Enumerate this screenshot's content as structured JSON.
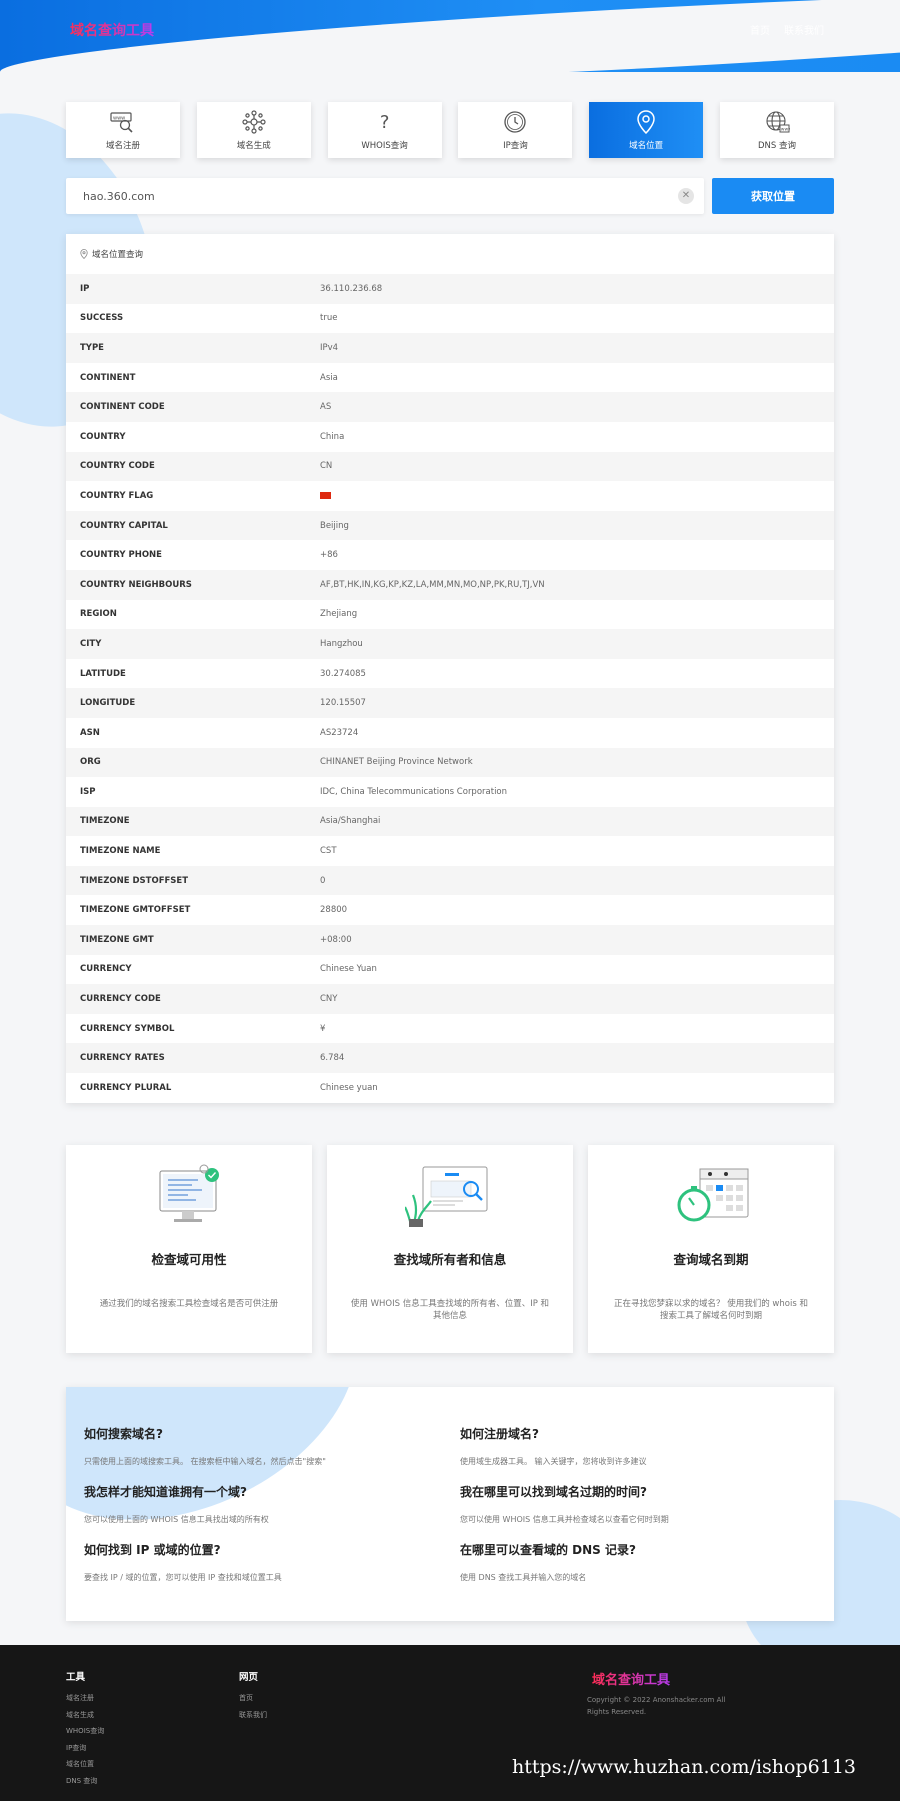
{
  "header": {
    "logo": "域名查询工具",
    "nav": [
      "首页",
      "联系我们"
    ]
  },
  "tabs": [
    {
      "label": "域名注册",
      "icon": "domain-search-icon"
    },
    {
      "label": "域名生成",
      "icon": "network-icon"
    },
    {
      "label": "WHOIS查询",
      "icon": "question-icon"
    },
    {
      "label": "IP查询",
      "icon": "clock-icon"
    },
    {
      "label": "域名位置",
      "icon": "location-pin-icon",
      "active": true
    },
    {
      "label": "DNS 查询",
      "icon": "globe-icon"
    }
  ],
  "search": {
    "value": "hao.360.com",
    "button_label": "获取位置"
  },
  "result": {
    "title": "域名位置查询",
    "rows": [
      {
        "key": "IP",
        "value": "36.110.236.68"
      },
      {
        "key": "SUCCESS",
        "value": "true"
      },
      {
        "key": "TYPE",
        "value": "IPv4"
      },
      {
        "key": "CONTINENT",
        "value": "Asia"
      },
      {
        "key": "CONTINENT CODE",
        "value": "AS"
      },
      {
        "key": "COUNTRY",
        "value": "China"
      },
      {
        "key": "COUNTRY CODE",
        "value": "CN"
      },
      {
        "key": "COUNTRY FLAG",
        "value": ""
      },
      {
        "key": "COUNTRY CAPITAL",
        "value": "Beijing"
      },
      {
        "key": "COUNTRY PHONE",
        "value": "+86"
      },
      {
        "key": "COUNTRY NEIGHBOURS",
        "value": "AF,BT,HK,IN,KG,KP,KZ,LA,MM,MN,MO,NP,PK,RU,TJ,VN"
      },
      {
        "key": "REGION",
        "value": "Zhejiang"
      },
      {
        "key": "CITY",
        "value": "Hangzhou"
      },
      {
        "key": "LATITUDE",
        "value": "30.274085"
      },
      {
        "key": "LONGITUDE",
        "value": "120.15507"
      },
      {
        "key": "ASN",
        "value": "AS23724"
      },
      {
        "key": "ORG",
        "value": "CHINANET Beijing Province Network"
      },
      {
        "key": "ISP",
        "value": "IDC, China Telecommunications Corporation"
      },
      {
        "key": "TIMEZONE",
        "value": "Asia/Shanghai"
      },
      {
        "key": "TIMEZONE NAME",
        "value": "CST"
      },
      {
        "key": "TIMEZONE DSTOFFSET",
        "value": "0"
      },
      {
        "key": "TIMEZONE GMTOFFSET",
        "value": "28800"
      },
      {
        "key": "TIMEZONE GMT",
        "value": "+08:00"
      },
      {
        "key": "CURRENCY",
        "value": "Chinese Yuan"
      },
      {
        "key": "CURRENCY CODE",
        "value": "CNY"
      },
      {
        "key": "CURRENCY SYMBOL",
        "value": "¥"
      },
      {
        "key": "CURRENCY RATES",
        "value": "6.784"
      },
      {
        "key": "CURRENCY PLURAL",
        "value": "Chinese yuan"
      }
    ]
  },
  "features": [
    {
      "title": "检查域可用性",
      "desc": "通过我们的域名搜索工具检查域名是否可供注册"
    },
    {
      "title": "查找域所有者和信息",
      "desc": "使用 WHOIS 信息工具查找域的所有者、位置、IP 和其他信息"
    },
    {
      "title": "查询域名到期",
      "desc": "正在寻找您梦寐以求的域名？ 使用我们的 whois 和搜索工具了解域名何时到期"
    }
  ],
  "faq": [
    {
      "q": "如何搜索域名?",
      "a": "只需使用上面的域搜索工具。 在搜索框中输入域名，然后点击\"搜索\""
    },
    {
      "q": "如何注册域名?",
      "a": "使用域生成器工具。 输入关键字，您将收到许多建议"
    },
    {
      "q": "我怎样才能知道谁拥有一个域?",
      "a": "您可以使用上面的 WHOIS 信息工具找出域的所有权"
    },
    {
      "q": "我在哪里可以找到域名过期的时间?",
      "a": "您可以使用 WHOIS 信息工具并检查域名以查看它何时到期"
    },
    {
      "q": "如何找到 IP 或域的位置?",
      "a": "要查找 IP / 域的位置，您可以使用 IP 查找和域位置工具"
    },
    {
      "q": "在哪里可以查看域的 DNS 记录?",
      "a": "使用 DNS 查找工具并输入您的域名"
    }
  ],
  "footer": {
    "col1": {
      "title": "工具",
      "links": [
        "域名注册",
        "域名生成",
        "WHOIS查询",
        "IP查询",
        "域名位置",
        "DNS 查询"
      ]
    },
    "col2": {
      "title": "网页",
      "links": [
        "首页",
        "联系我们"
      ]
    },
    "logo": "域名查询工具",
    "copyright": "Copyright © 2022 Anonshacker.com All Rights Reserved."
  },
  "watermark": "https://www.huzhan.com/ishop6113"
}
